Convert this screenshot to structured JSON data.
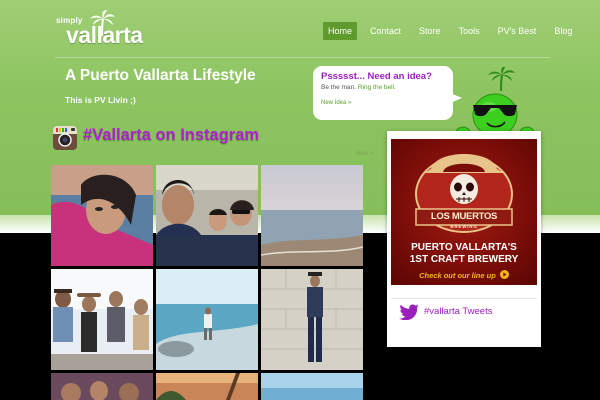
{
  "logo": {
    "prefix": "simply",
    "name": "vallarta"
  },
  "nav": {
    "items": [
      "Home",
      "Contact",
      "Store",
      "Tools",
      "PV's Best",
      "Blog"
    ],
    "active_index": 0
  },
  "hero": {
    "title": "A Puerto Vallarta Lifestyle",
    "subtitle": "This is PV Livin ;)"
  },
  "bubble": {
    "heading": "Pssssst... Need an idea?",
    "text": "Be the man.",
    "link_text": "Ring the bell.",
    "more_link": "New Idea »"
  },
  "instagram": {
    "heading": "#Vallarta on Instagram",
    "next_label": "Next »"
  },
  "ad": {
    "brand": "LOS MUERTOS",
    "brand_sub": "BREWING",
    "line1": "PUERTO VALLARTA'S",
    "line2": "1ST CRAFT BREWERY",
    "line3": "Check out our line up"
  },
  "tweets": {
    "label": "#vallarta Tweets"
  },
  "colors": {
    "accent_purple": "#9b1fbf",
    "nav_active": "#5e9a2c",
    "header_green": "#8cc45f",
    "link_green": "#5a9e2a"
  }
}
